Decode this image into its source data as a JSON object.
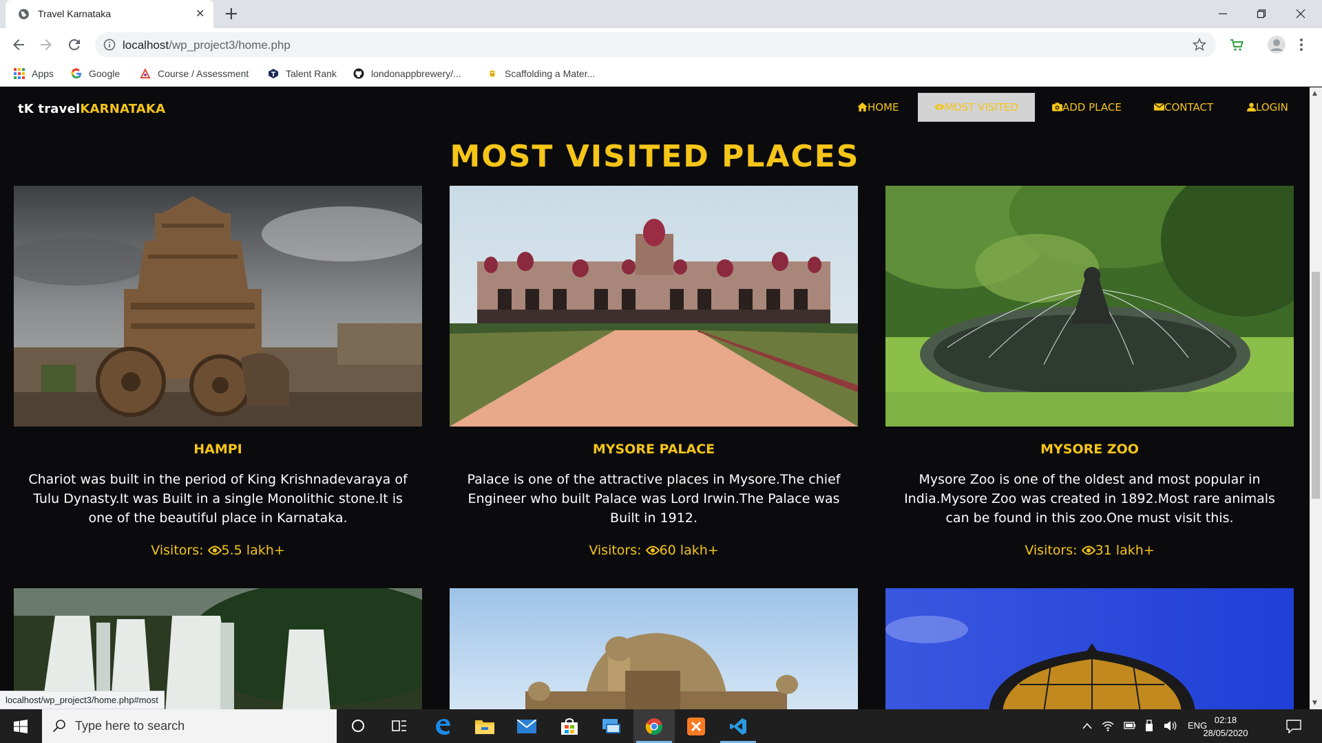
{
  "browser": {
    "tab_title": "Travel Karnataka",
    "url_host": "localhost",
    "url_path": "/wp_project3/home.php",
    "bookmarks": [
      {
        "label": "Apps",
        "icon": "apps-grid-icon"
      },
      {
        "label": "Google",
        "icon": "google-icon"
      },
      {
        "label": "Course / Assessment",
        "icon": "course-icon"
      },
      {
        "label": "Talent Rank",
        "icon": "talent-rank-icon"
      },
      {
        "label": "londonappbrewery/...",
        "icon": "github-icon"
      },
      {
        "label": "Scaffolding a Mater...",
        "icon": "scaffolding-icon"
      }
    ],
    "status_link": "localhost/wp_project3/home.php#most"
  },
  "site": {
    "brand_tk": "tK",
    "brand_travel": "travel",
    "brand_karnataka": "KARNATAKA",
    "nav": [
      {
        "label": "HOME",
        "icon": "home-icon"
      },
      {
        "label": "MOST VISITED",
        "icon": "eye-icon",
        "active": true
      },
      {
        "label": "ADD PLACE",
        "icon": "camera-icon"
      },
      {
        "label": "CONTACT",
        "icon": "envelope-icon"
      },
      {
        "label": "LOGIN",
        "icon": "user-icon"
      }
    ],
    "heading": "MOST VISITED PLACES",
    "places": [
      {
        "title": "HAMPI",
        "description": "Chariot was built in the period of King Krishnadevaraya of Tulu Dynasty.It was Built in a single Monolithic stone.It is one of the beautiful place in Karnataka.",
        "visitors_label": "Visitors: ",
        "visitors_value": "5.5 lakh+"
      },
      {
        "title": "MYSORE PALACE",
        "description": "Palace is one of the attractive places in Mysore.The chief Engineer who built Palace was Lord Irwin.The Palace was Built in 1912.",
        "visitors_label": "Visitors: ",
        "visitors_value": "60 lakh+"
      },
      {
        "title": "MYSORE ZOO",
        "description": "Mysore Zoo is one of the oldest and most popular in India.Mysore Zoo was created in 1892.Most rare animals can be found in this zoo.One must visit this.",
        "visitors_label": "Visitors: ",
        "visitors_value": "31 lakh+"
      }
    ]
  },
  "taskbar": {
    "search_placeholder": "Type here to search",
    "language": "ENG",
    "time": "02:18",
    "date": "28/05/2020"
  },
  "colors": {
    "accent": "#f5c518",
    "page_bg": "#0b0b0d",
    "active_nav_bg": "#d3d3d3"
  }
}
